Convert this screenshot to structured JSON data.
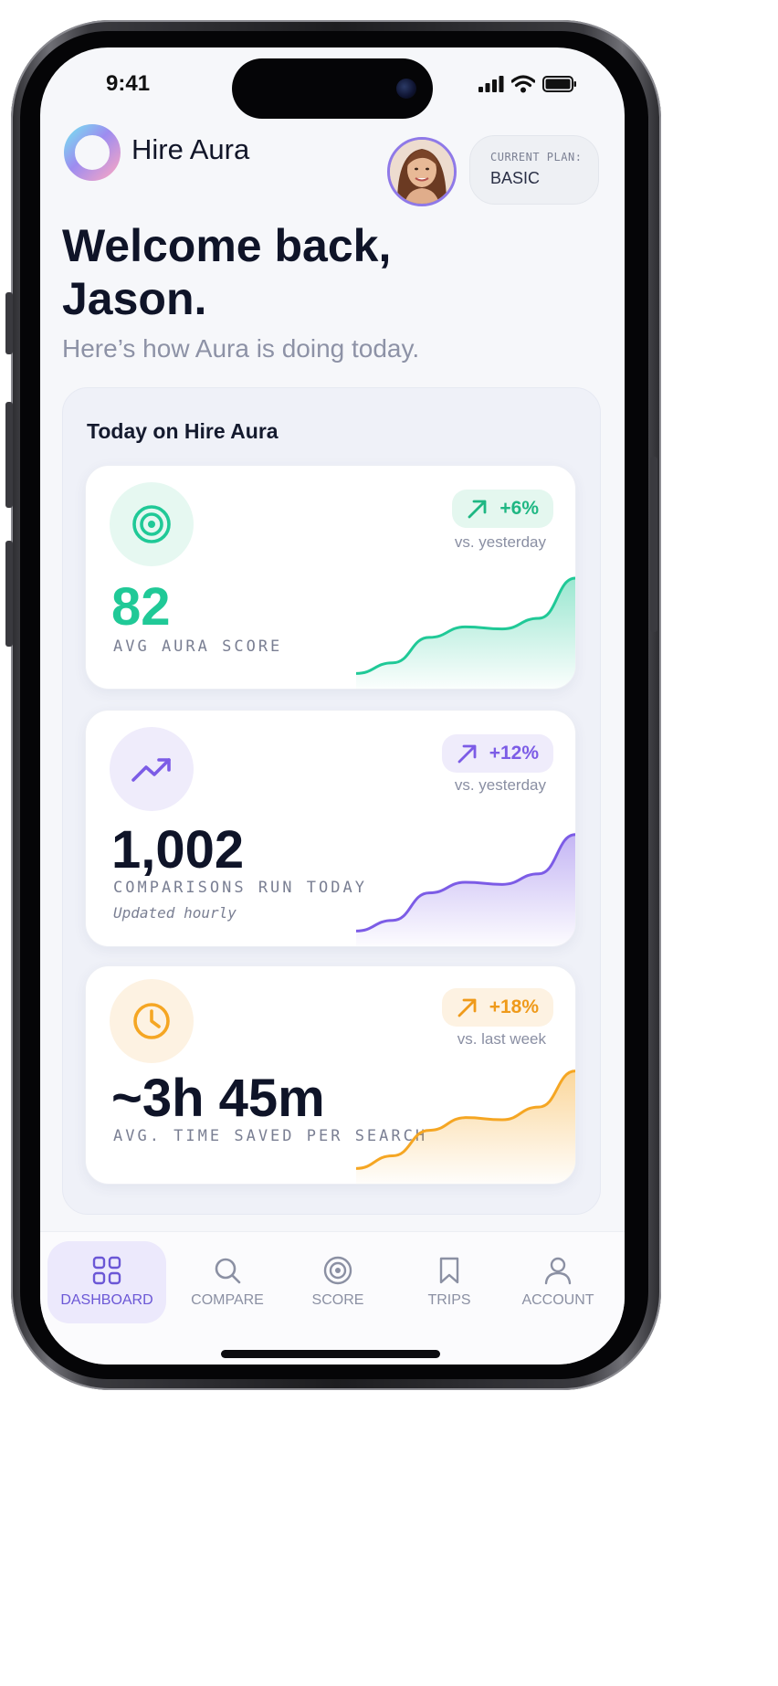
{
  "status_bar": {
    "time": "9:41"
  },
  "header": {
    "brand": "Hire Aura",
    "plan_label": "CURRENT PLAN:",
    "plan_value": "BASIC",
    "welcome_line1": "Welcome back,",
    "welcome_line2": "Jason.",
    "subtitle": "Here’s how Aura is doing today."
  },
  "panel": {
    "title": "Today on Hire Aura",
    "cards": [
      {
        "icon": "target-icon",
        "value": "82",
        "label": "AVG AURA SCORE",
        "change": "+6%",
        "change_note": "vs. yesterday",
        "color": "#20c997",
        "trend": [
          0.04,
          0.14,
          0.38,
          0.48,
          0.46,
          0.56,
          0.94
        ]
      },
      {
        "icon": "trending-up-icon",
        "value": "1,002",
        "label": "COMPARISONS RUN TODAY",
        "note": "Updated hourly",
        "change": "+12%",
        "change_note": "vs. yesterday",
        "color": "#7c5ce6",
        "trend": [
          0.04,
          0.14,
          0.4,
          0.5,
          0.48,
          0.58,
          0.95
        ]
      },
      {
        "icon": "clock-icon",
        "value": "~3h 45m",
        "label": "AVG. TIME SAVED PER SEARCH",
        "change": "+18%",
        "change_note": "vs. last week",
        "color": "#f5a623",
        "trend": [
          0.04,
          0.16,
          0.4,
          0.52,
          0.5,
          0.62,
          0.96
        ]
      }
    ]
  },
  "tabbar": {
    "tabs": [
      {
        "label": "DASHBOARD",
        "icon": "grid-icon"
      },
      {
        "label": "COMPARE",
        "icon": "search-icon"
      },
      {
        "label": "SCORE",
        "icon": "target-icon"
      },
      {
        "label": "TRIPS",
        "icon": "bookmark-icon"
      },
      {
        "label": "ACCOUNT",
        "icon": "user-icon"
      }
    ],
    "active": "DASHBOARD"
  }
}
